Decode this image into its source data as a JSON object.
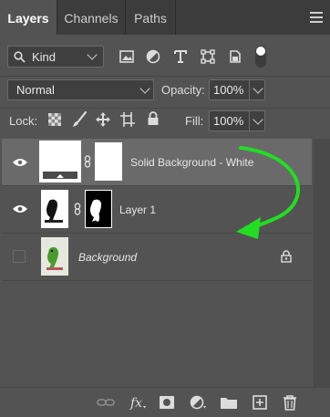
{
  "tabs": [
    {
      "label": "Layers"
    },
    {
      "label": "Channels"
    },
    {
      "label": "Paths"
    }
  ],
  "filter": {
    "kind_label": "Kind"
  },
  "blend": {
    "mode": "Normal",
    "opacity_label": "Opacity:",
    "opacity_value": "100%"
  },
  "lock": {
    "label": "Lock:",
    "fill_label": "Fill:",
    "fill_value": "100%"
  },
  "layers": [
    {
      "name": "Solid Background - White",
      "visible": true,
      "selected": true
    },
    {
      "name": "Layer 1",
      "visible": true,
      "selected": false
    },
    {
      "name": "Background",
      "visible": false,
      "selected": false,
      "locked": true
    }
  ],
  "colors": {
    "arrow": "#22dd22",
    "panel": "#535353",
    "selected_row": "#6a6a6a"
  }
}
